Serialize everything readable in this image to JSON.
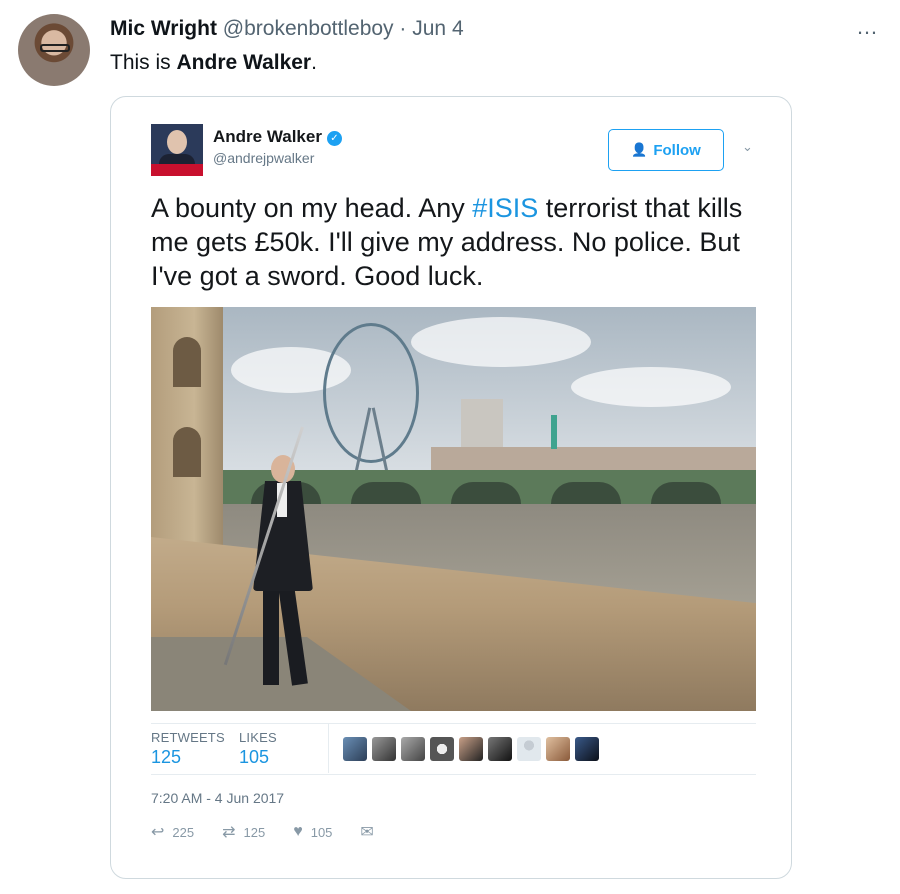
{
  "post": {
    "author_name": "Mic Wright",
    "author_handle": "@brokenbottleboy",
    "separator": "·",
    "date": "Jun 4",
    "text_prefix": "This is ",
    "text_bold": "Andre Walker",
    "text_suffix": ".",
    "more_icon": "…"
  },
  "quoted": {
    "name": "Andre Walker",
    "handle": "@andrejpwalker",
    "verified_icon": "verified-badge",
    "follow_label": "Follow",
    "text_before": "A bounty on my head. Any ",
    "hashtag": "#ISIS",
    "text_after": " terrorist that kills me gets £50k. I'll give my address. No police. But I've got a sword. Good luck.",
    "stats": {
      "retweets_label": "RETWEETS",
      "retweets_value": "125",
      "likes_label": "LIKES",
      "likes_value": "105"
    },
    "timestamp": "7:20 AM - 4 Jun 2017",
    "actions": {
      "reply_count": "225",
      "retweet_count": "125",
      "like_count": "105"
    }
  },
  "colors": {
    "accent": "#1da1f2",
    "link": "#1b95e0",
    "muted": "#657786"
  }
}
